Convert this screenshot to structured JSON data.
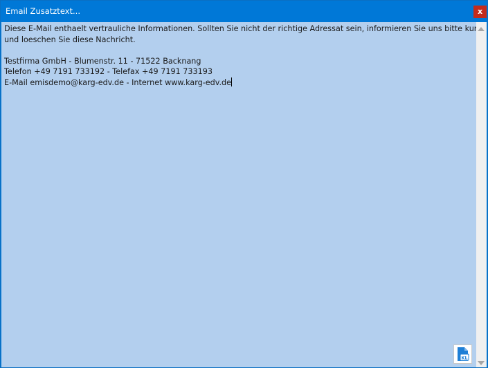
{
  "window": {
    "title": "Email Zusatztext...",
    "close_label": "x"
  },
  "editor": {
    "lines": [
      "Diese E-Mail enthaelt vertrauliche Informationen. Sollten Sie nicht der richtige Adressat sein, informieren Sie uns bitte kurz",
      "und loeschen Sie diese Nachricht.",
      "",
      "Testfirma GmbH - Blumenstr. 11 - 71522 Backnang",
      "Telefon +49 7191 733192 - Telefax +49 7191 733193",
      "E-Mail emisdemo@karg-edv.de - Internet www.karg-edv.de"
    ]
  },
  "doc_button": {
    "icon": "document-kl-icon",
    "badge": "KL"
  },
  "colors": {
    "titlebar": "#0078d7",
    "close": "#c42b1c",
    "editor_bg": "#b3cfee",
    "scrollbar": "#f0f0f0",
    "doc_icon": "#1e7fd6"
  }
}
